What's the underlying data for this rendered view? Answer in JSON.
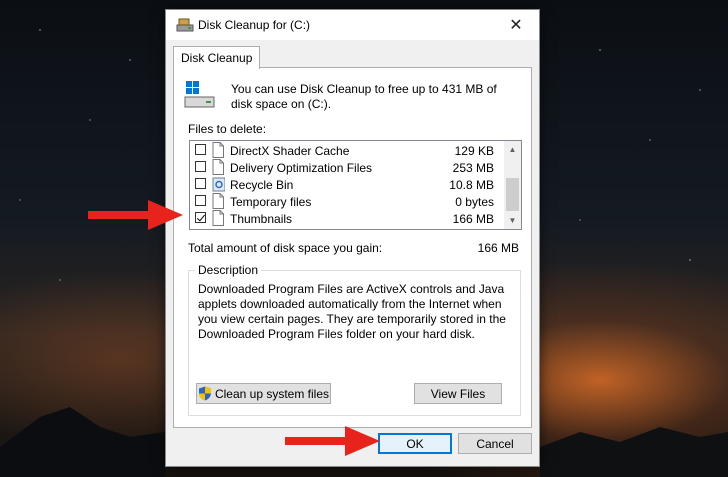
{
  "window": {
    "title": "Disk Cleanup for  (C:)",
    "close_glyph": "✕"
  },
  "tabs": [
    {
      "label": "Disk Cleanup"
    }
  ],
  "intro_text": "You can use Disk Cleanup to free up to 431 MB of disk space on  (C:).",
  "files_label": "Files to delete:",
  "files": [
    {
      "name": "DirectX Shader Cache",
      "size": "129 KB",
      "checked": false,
      "icon": "file-icon"
    },
    {
      "name": "Delivery Optimization Files",
      "size": "253 MB",
      "checked": false,
      "icon": "file-icon"
    },
    {
      "name": "Recycle Bin",
      "size": "10.8 MB",
      "checked": false,
      "icon": "recycle-bin-icon"
    },
    {
      "name": "Temporary files",
      "size": "0 bytes",
      "checked": false,
      "icon": "file-icon"
    },
    {
      "name": "Thumbnails",
      "size": "166 MB",
      "checked": true,
      "icon": "file-icon"
    }
  ],
  "total": {
    "label": "Total amount of disk space you gain:",
    "value": "166 MB"
  },
  "description": {
    "title": "Description",
    "text": "Downloaded Program Files are ActiveX controls and Java applets downloaded automatically from the Internet when you view certain pages. They are temporarily stored in the Downloaded Program Files folder on your hard disk."
  },
  "buttons": {
    "cleanup": "Clean up system files",
    "view": "View Files",
    "ok": "OK",
    "cancel": "Cancel"
  },
  "colors": {
    "accent": "#0078d7",
    "arrow": "#e8231b"
  }
}
